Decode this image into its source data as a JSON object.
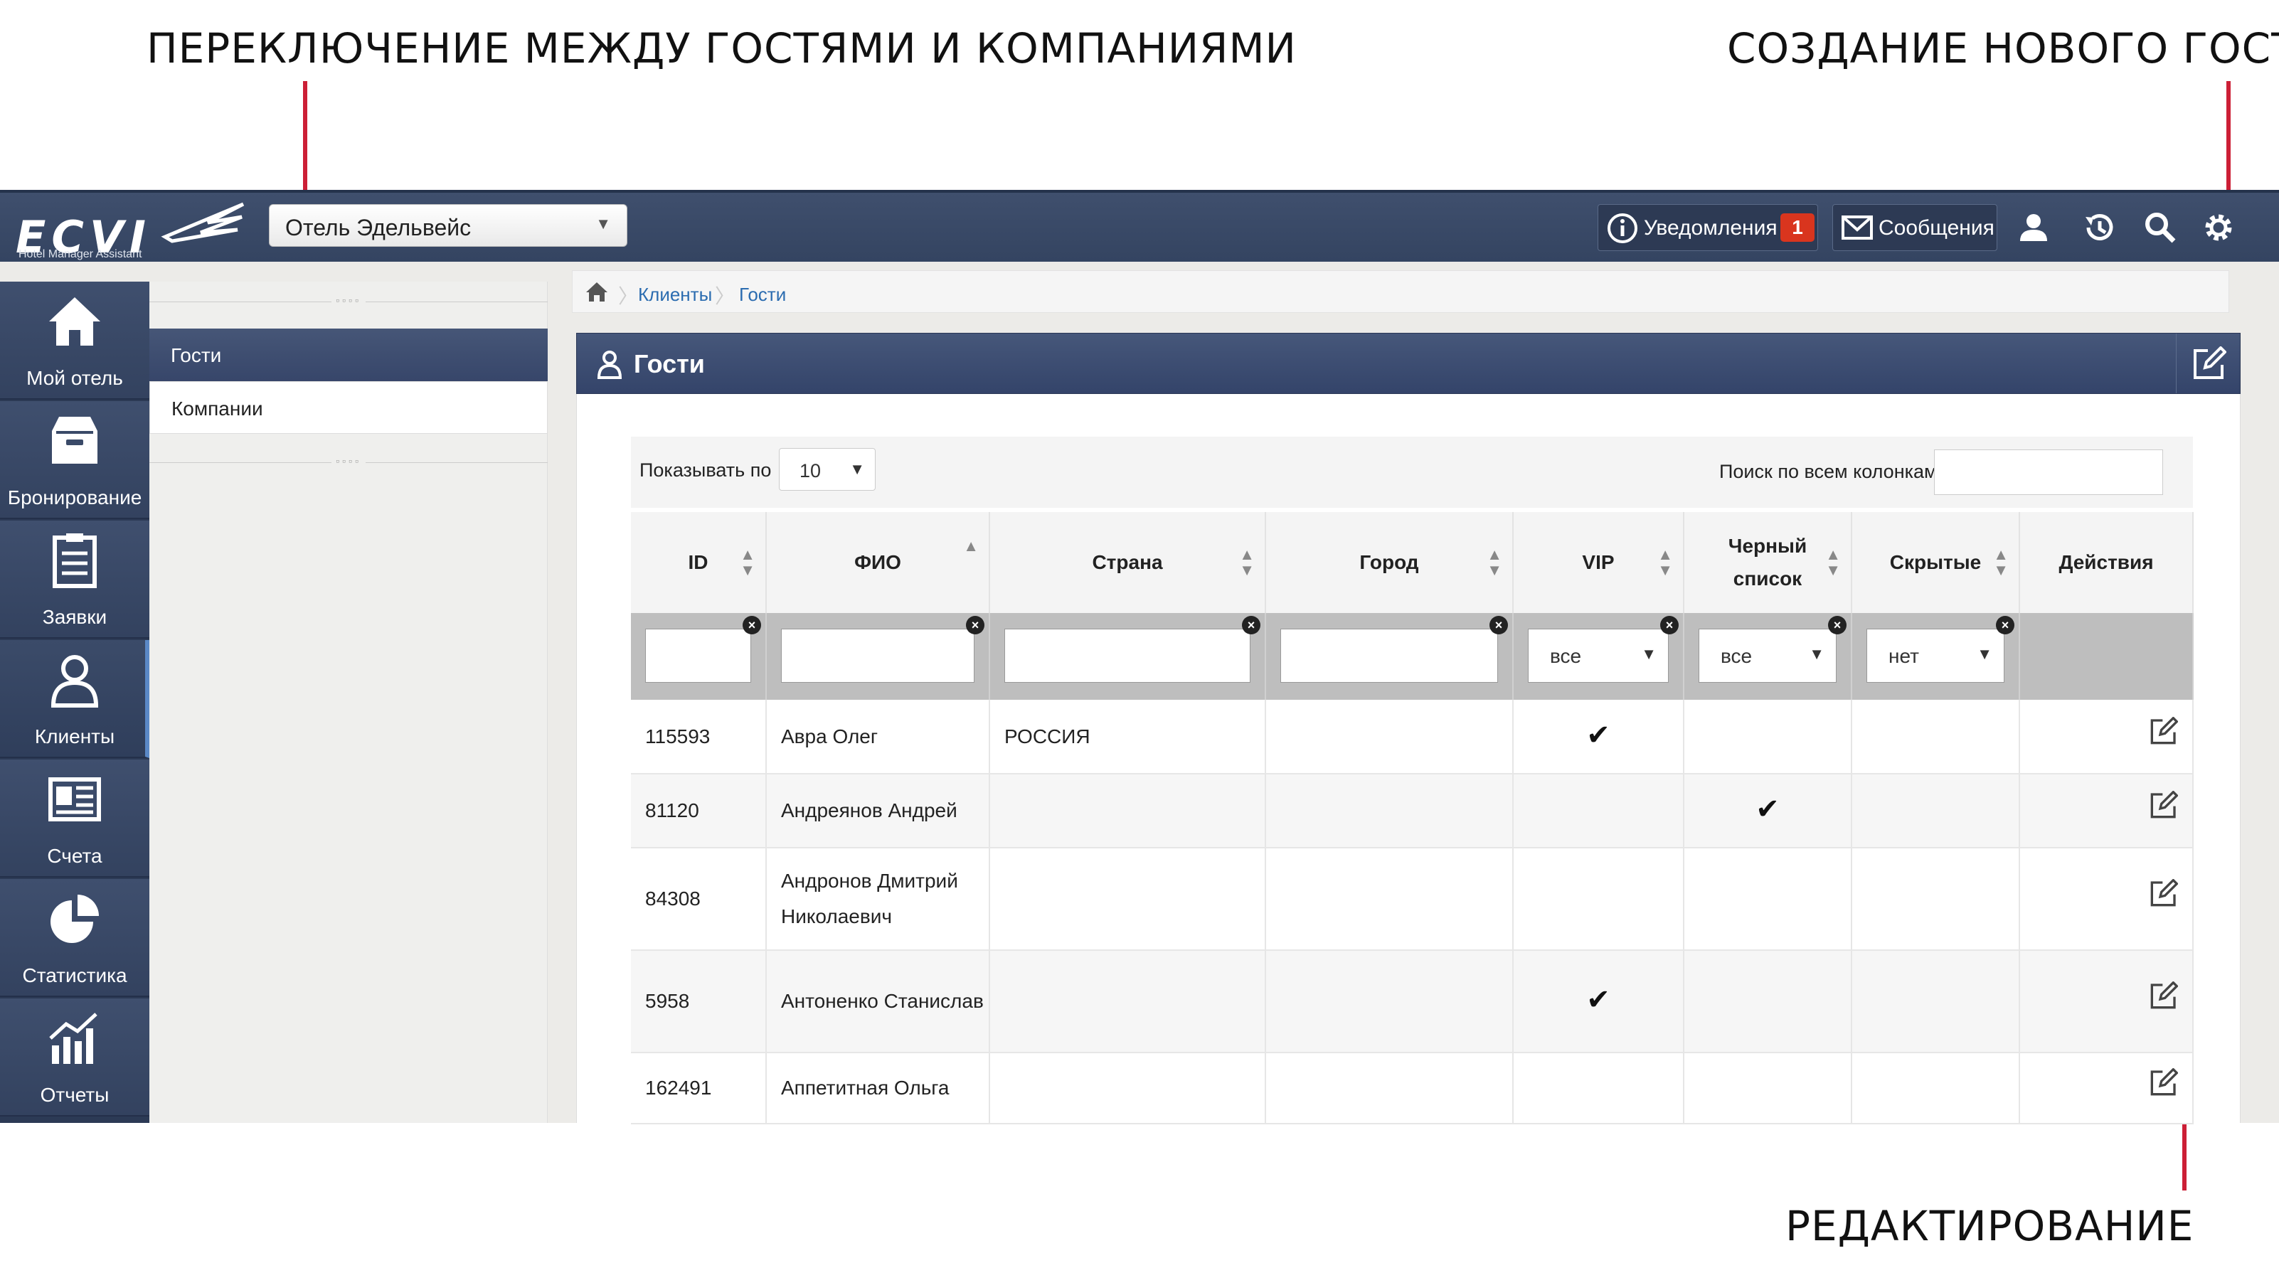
{
  "annotations": {
    "switch_label": "ПЕРЕКЛЮЧЕНИЕ МЕЖДУ ГОСТЯМИ И КОМПАНИЯМИ",
    "create_label": "СОЗДАНИЕ НОВОГО ГОСТЯ",
    "edit_label": "РЕДАКТИРОВАНИЕ",
    "accent_color": "#cc1f36"
  },
  "app": {
    "logo_text": "ECVI",
    "logo_subtitle": "Hotel Manager Assistant",
    "hotel": "Отель Эдельвейс",
    "notifications_label": "Уведомления",
    "notifications_count": "1",
    "messages_label": "Сообщения",
    "icons": [
      "user-icon",
      "history-icon",
      "search-icon",
      "gear-icon"
    ]
  },
  "nav": {
    "items": [
      {
        "label": "Мой отель",
        "icon": "home-icon"
      },
      {
        "label": "Бронирование",
        "icon": "archive-icon"
      },
      {
        "label": "Заявки",
        "icon": "clipboard-icon"
      },
      {
        "label": "Клиенты",
        "icon": "user-icon",
        "active": true
      },
      {
        "label": "Счета",
        "icon": "invoice-icon"
      },
      {
        "label": "Статистика",
        "icon": "pie-chart-icon"
      },
      {
        "label": "Отчеты",
        "icon": "bar-chart-icon"
      }
    ]
  },
  "submenu": {
    "items": [
      {
        "label": "Гости",
        "active": true
      },
      {
        "label": "Компании",
        "active": false
      }
    ]
  },
  "breadcrumb": {
    "items": [
      "Клиенты",
      "Гости"
    ]
  },
  "panel": {
    "title": "Гости"
  },
  "table_tools": {
    "show_label": "Показывать по",
    "page_length": "10",
    "search_label": "Поиск по всем колонкам:",
    "search_value": ""
  },
  "table": {
    "columns": [
      "ID",
      "ФИО",
      "Страна",
      "Город",
      "VIP",
      "Черный список",
      "Скрытые",
      "Действия"
    ],
    "filters": {
      "vip": "все",
      "blacklist": "все",
      "hidden": "нет"
    },
    "rows": [
      {
        "id": "115593",
        "name": "Авра Олег",
        "country": "РОССИЯ",
        "city": "",
        "vip": true,
        "blacklist": false
      },
      {
        "id": "81120",
        "name": "Андреянов Андрей",
        "country": "",
        "city": "",
        "vip": false,
        "blacklist": true
      },
      {
        "id": "84308",
        "name": "Андронов Дмитрий Николаевич",
        "country": "",
        "city": "",
        "vip": false,
        "blacklist": false
      },
      {
        "id": "5958",
        "name": "Антоненко Станислав",
        "country": "",
        "city": "",
        "vip": true,
        "blacklist": false
      },
      {
        "id": "162491",
        "name": "Аппетитная Ольга",
        "country": "",
        "city": "",
        "vip": false,
        "blacklist": false
      }
    ]
  }
}
